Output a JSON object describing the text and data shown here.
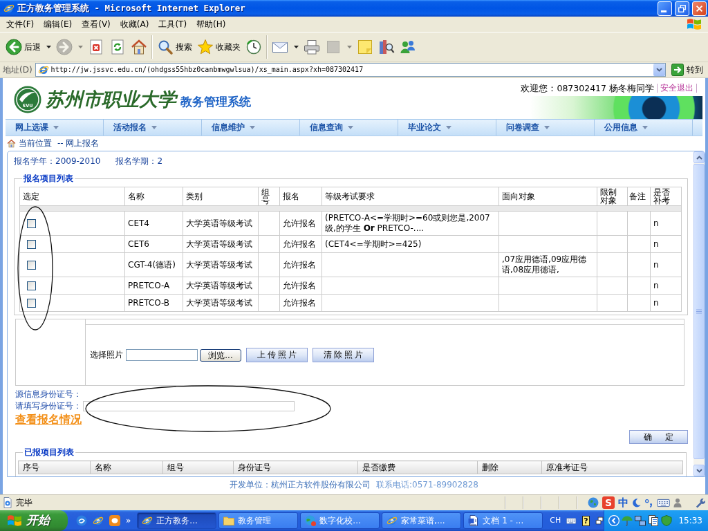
{
  "window": {
    "title": "正方教务管理系统 - Microsoft Internet Explorer"
  },
  "menu_bar": [
    "文件(F)",
    "编辑(E)",
    "查看(V)",
    "收藏(A)",
    "工具(T)",
    "帮助(H)"
  ],
  "toolbar": {
    "groups": [
      [
        {
          "kind": "back",
          "label": "后退",
          "menu": true,
          "disabled": false
        },
        {
          "kind": "forward",
          "menu": true,
          "disabled": true
        },
        {
          "kind": "stop",
          "disabled": false
        },
        {
          "kind": "refresh",
          "disabled": false
        },
        {
          "kind": "home",
          "disabled": false
        }
      ],
      [
        {
          "kind": "search",
          "label": "搜索",
          "disabled": false
        },
        {
          "kind": "favorites",
          "label": "收藏夹",
          "disabled": false
        },
        {
          "kind": "history",
          "disabled": false
        }
      ],
      [
        {
          "kind": "mail",
          "menu": true,
          "disabled": false
        },
        {
          "kind": "print",
          "disabled": false
        },
        {
          "kind": "edit",
          "menu": true,
          "disabled": true
        },
        {
          "kind": "notes",
          "disabled": false
        },
        {
          "kind": "research",
          "disabled": false
        },
        {
          "kind": "messenger",
          "disabled": false
        }
      ]
    ]
  },
  "address_bar": {
    "label": "地址(D)",
    "url": "http://jw.jssvc.edu.cn/(ohdgss55hbz0canbmwgwlsua)/xs_main.aspx?xh=087302417",
    "go": "转到"
  },
  "header": {
    "logo_text": "SVU",
    "school_name": "苏州市职业大学",
    "system_name": "教务管理系统",
    "welcome": "欢迎您：087302417 杨冬梅同学",
    "logout": "安全退出"
  },
  "nav": [
    "网上选课",
    "活动报名",
    "信息维护",
    "信息查询",
    "毕业论文",
    "问卷调查",
    "公用信息"
  ],
  "breadcrumb": {
    "label": "当前位置",
    "path": "-- 网上报名"
  },
  "term": {
    "year": "报名学年：2009-2010",
    "term": "报名学期：2"
  },
  "projects": {
    "legend": "报名项目列表",
    "columns": [
      "选定",
      "名称",
      "类别",
      "组号",
      "报名",
      "等级考试要求",
      "面向对象",
      "限制对象",
      "备注",
      "是否补考"
    ],
    "rows": [
      {
        "checked": false,
        "name": "CET4",
        "category": "大学英语等级考试",
        "status": "允许报名",
        "requirement": "(PRETCO-A<=学期时>=60或则您是,2007级,的学生 **Or** PRETCO-....",
        "makeup": "n"
      },
      {
        "checked": false,
        "name": "CET6",
        "category": "大学英语等级考试",
        "status": "允许报名",
        "requirement": "(CET4<=学期时>=425)",
        "makeup": "n"
      },
      {
        "checked": false,
        "name": "CGT-4(德语)",
        "category": "大学英语等级考试",
        "status": "允许报名",
        "target": ",07应用德语,09应用德语,08应用德语,",
        "makeup": "n"
      },
      {
        "checked": false,
        "name": "PRETCO-A",
        "category": "大学英语等级考试",
        "status": "允许报名",
        "makeup": "n"
      },
      {
        "checked": false,
        "name": "PRETCO-B",
        "category": "大学英语等级考试",
        "status": "允许报名",
        "makeup": "n"
      }
    ]
  },
  "photo": {
    "label": "选择照片",
    "browse": "浏览...",
    "upload": "上传照片",
    "clear": "清除照片"
  },
  "identity": {
    "source_label": "源信息身份证号：",
    "input_label": "请填写身份证号：",
    "view_link": "查看报名情况",
    "confirm": "确 定"
  },
  "registered": {
    "legend": "已报项目列表",
    "columns": [
      "序号",
      "名称",
      "组号",
      "身份证号",
      "是否缴费",
      "删除",
      "原准考证号"
    ]
  },
  "footer": {
    "developer": "开发单位：杭州正方软件股份有限公司",
    "phone": "联系电话:0571-89902828"
  },
  "status_bar": {
    "text": "完毕",
    "ime_logo": "S",
    "ime_mode": "中"
  },
  "taskbar": {
    "start": "开始",
    "quick_launch": [
      {
        "kind": "media"
      },
      {
        "kind": "browser"
      },
      {
        "kind": "chat"
      }
    ],
    "more": "»",
    "tasks": [
      {
        "kind": "browser",
        "label": "正方教务...",
        "selected": true
      },
      {
        "kind": "folder",
        "label": "教务管理",
        "selected": false
      },
      {
        "kind": "app",
        "label": "数字化校...",
        "selected": false
      },
      {
        "kind": "browser",
        "label": "家常菜谱,...",
        "selected": false
      },
      {
        "kind": "document",
        "label": "文档 1 - ...",
        "selected": false
      }
    ],
    "language": "CH",
    "help": "?",
    "clock": "15:33"
  }
}
